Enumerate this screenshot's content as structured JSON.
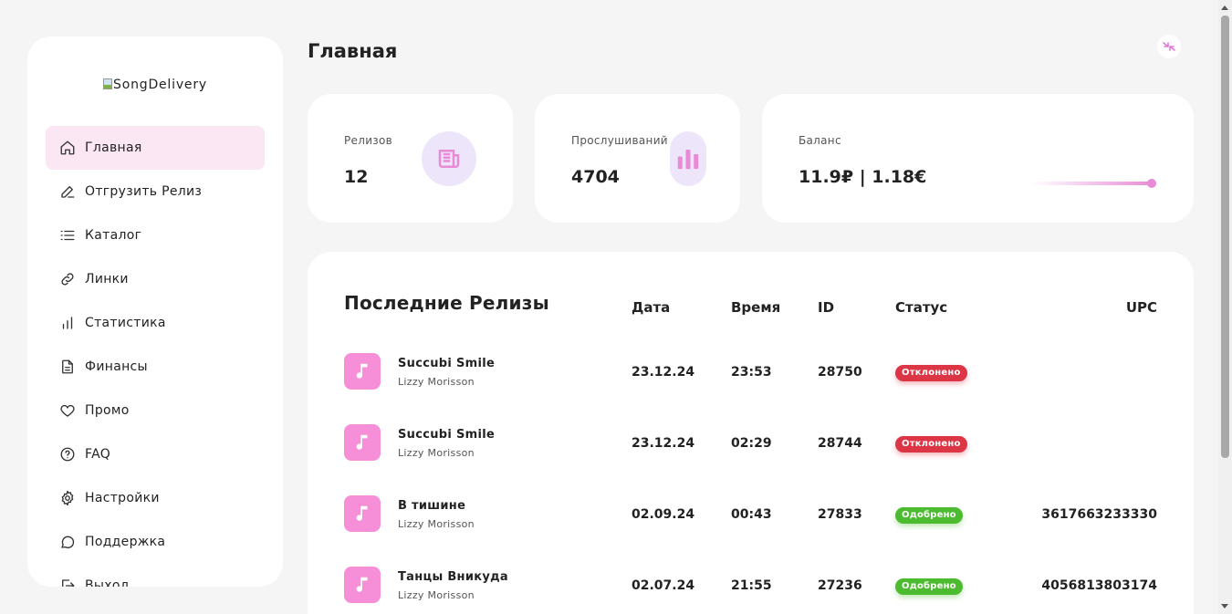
{
  "sidebar": {
    "logo_alt": "SongDelivery",
    "items": [
      {
        "label": "Главная",
        "icon": "home-icon",
        "active": true
      },
      {
        "label": "Отгрузить Релиз",
        "icon": "pencil-icon"
      },
      {
        "label": "Каталог",
        "icon": "list-icon"
      },
      {
        "label": "Линки",
        "icon": "link-icon"
      },
      {
        "label": "Статистика",
        "icon": "bar-chart-icon"
      },
      {
        "label": "Финансы",
        "icon": "document-icon"
      },
      {
        "label": "Промо",
        "icon": "heart-icon"
      },
      {
        "label": "FAQ",
        "icon": "question-icon"
      },
      {
        "label": "Настройки",
        "icon": "gear-icon"
      },
      {
        "label": "Поддержка",
        "icon": "chat-icon"
      },
      {
        "label": "Выход",
        "icon": "logout-icon"
      }
    ]
  },
  "header": {
    "title": "Главная",
    "collapse_icon": "collapse-icon"
  },
  "stats": {
    "releases": {
      "label": "Релизов",
      "value": "12",
      "icon": "newspaper-icon"
    },
    "streams": {
      "label": "Прослушиваний",
      "value": "4704",
      "icon": "bar-chart-icon"
    },
    "balance": {
      "label": "Баланс",
      "value": "11.9₽ | 1.18€",
      "progress": 1.0
    }
  },
  "releases": {
    "title": "Последние Релизы",
    "columns": {
      "date": "Дата",
      "time": "Время",
      "id": "ID",
      "status": "Статус",
      "upc": "UPC"
    },
    "rows": [
      {
        "title": "Succubi Smile",
        "artist": "Lizzy Morisson",
        "date": "23.12.24",
        "time": "23:53",
        "id": "28750",
        "status": "Отклонено",
        "status_type": "rejected",
        "upc": ""
      },
      {
        "title": "Succubi Smile",
        "artist": "Lizzy Morisson",
        "date": "23.12.24",
        "time": "02:29",
        "id": "28744",
        "status": "Отклонено",
        "status_type": "rejected",
        "upc": ""
      },
      {
        "title": "В тишине",
        "artist": "Lizzy Morisson",
        "date": "02.09.24",
        "time": "00:43",
        "id": "27833",
        "status": "Одобрено",
        "status_type": "approved",
        "upc": "3617663233330"
      },
      {
        "title": "Танцы Вникуда",
        "artist": "Lizzy Morisson",
        "date": "02.07.24",
        "time": "21:55",
        "id": "27236",
        "status": "Одобрено",
        "status_type": "approved",
        "upc": "4056813803174"
      }
    ]
  },
  "colors": {
    "accent": "#e88ad6",
    "active_bg": "#fbe6f4",
    "rejected": "#dc3545",
    "approved": "#4cbb2f",
    "cover": "#f78fd8"
  }
}
